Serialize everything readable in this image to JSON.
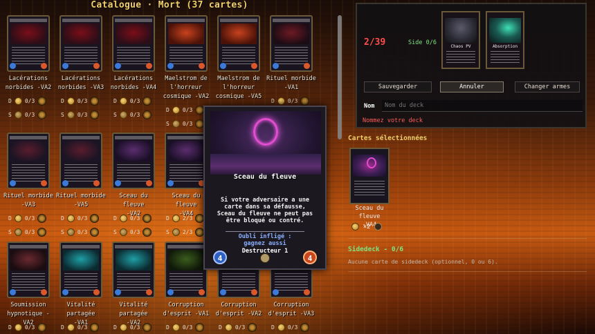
{
  "catalog": {
    "title": "Catalogue · Mort (37 cartes)",
    "cards": [
      {
        "name1": "Lacérations",
        "name2": "norbides -VA2",
        "owned": "0/3",
        "art": "#7a0e18",
        "art2": "#2a0e18"
      },
      {
        "name1": "Lacérations",
        "name2": "norbides -VA3",
        "owned": "0/3",
        "art": "#7a0e18",
        "art2": "#2a0e18"
      },
      {
        "name1": "Lacérations",
        "name2": "norbides -VA4",
        "owned": "0/3",
        "art": "#7a0e18",
        "art2": "#2a0e18"
      },
      {
        "name1": "Maelstrom de",
        "name2": "l'horreur",
        "name3": "cosmique -VA2",
        "owned": "0/3",
        "art": "#c8421e",
        "art2": "#4a1208"
      },
      {
        "name1": "Maelstrom de",
        "name2": "l'horreur",
        "name3": "cosmique -VA5",
        "owned": "0/3",
        "art": "#c8421e",
        "art2": "#4a1208"
      },
      {
        "name1": "Rituel morbide",
        "name2": "-VA1",
        "owned": "0/3",
        "art": "#6e1a24",
        "art2": "#1c0c14"
      },
      {
        "name1": "Rituel morbide",
        "name2": "-VA3",
        "owned": "0/3",
        "art": "#5a1c2c",
        "art2": "#1a1424"
      },
      {
        "name1": "Rituel morbide",
        "name2": "-VA5",
        "owned": "0/3",
        "art": "#5a1c2c",
        "art2": "#1a1424"
      },
      {
        "name1": "Sceau du fleuve",
        "name2": "-VA2",
        "owned": "0/3",
        "art": "#5b2d6e",
        "art2": "#1a0f26"
      },
      {
        "name1": "Sceau du fleuve",
        "name2": "-VA4",
        "owned": "2/3",
        "art": "#5b2d6e",
        "art2": "#1a0f26"
      },
      {
        "name1": "Soumission",
        "name2": "hypnotique -VA2",
        "owned": "0/3",
        "art": "#6a2a30",
        "art2": "#1a0c10"
      },
      {
        "name1": "Vitalité partagée",
        "name2": "-VA1",
        "owned": "0/3",
        "art": "#1e9fa5",
        "art2": "#0b2a30"
      },
      {
        "name1": "Vitalité partagée",
        "name2": "-VA2",
        "owned": "0/3",
        "art": "#1e9fa5",
        "art2": "#0b2a30"
      },
      {
        "name1": "Corruption",
        "name2": "d'esprit -VA1",
        "owned": "0/3",
        "art": "#3a5c1c",
        "art2": "#10180a"
      },
      {
        "name1": "Corruption",
        "name2": "d'esprit -VA2",
        "owned": "0/3",
        "art": "#3a5c1c",
        "art2": "#10180a"
      },
      {
        "name1": "Corruption",
        "name2": "d'esprit -VA3",
        "owned": "0/3",
        "art": "#3a5c1c",
        "art2": "#10180a"
      }
    ],
    "letter_d": "D",
    "letter_s": "S"
  },
  "popup": {
    "title": "Sceau du fleuve",
    "description": "Si votre adversaire a une carte dans sa défausse, Sceau du fleuve ne peut pas être bloqué ou contré.",
    "oubli_line1": "Oubli infligé :",
    "oubli_line2": "gagnez aussi",
    "destructeur": "Destructeur 1",
    "attack": "4",
    "defense": "4"
  },
  "deck": {
    "count": "2/39",
    "side": "Side 0/6",
    "thumb1_label": "Chaos PV",
    "thumb2_label": "Absorption",
    "save_label": "Sauvegarder",
    "cancel_label": "Annuler",
    "change_weapons_label": "Changer armes",
    "name_label": "Nom",
    "name_placeholder": "Nom du deck",
    "name_error": "Nommez votre deck"
  },
  "selected": {
    "title": "Cartes sélectionnées",
    "card_name1": "Sceau du fleuve",
    "card_name2": "-VA4",
    "qty": "×2"
  },
  "sidedeck": {
    "title": "Sidedeck - 0/6",
    "empty_text": "Aucune carte de sidedeck (optionnel, 0 ou 6)."
  }
}
